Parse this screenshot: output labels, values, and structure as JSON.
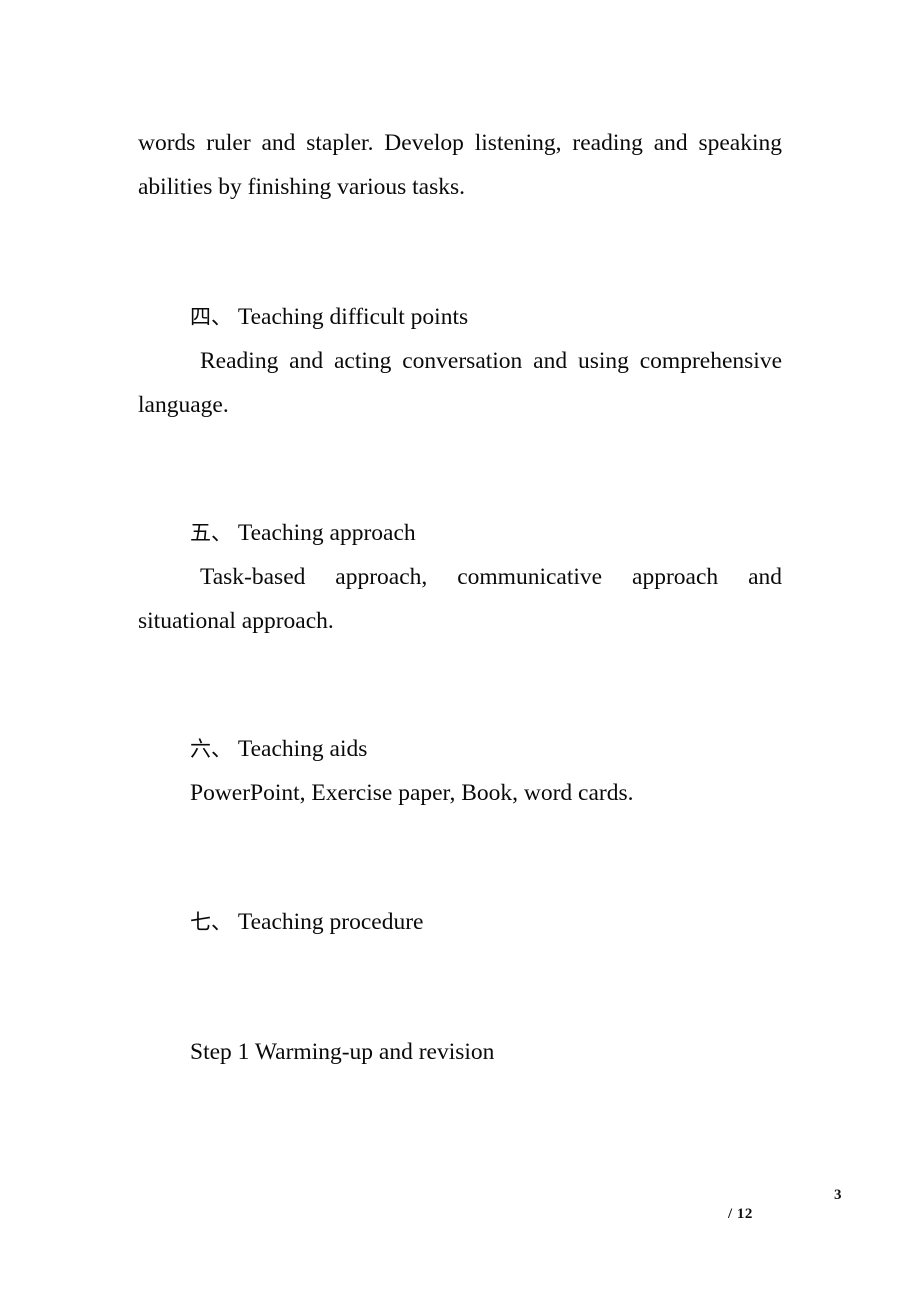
{
  "document": {
    "type": "lesson-plan",
    "language": "en-CN",
    "background_color": "#ffffff",
    "text_color": "#0a0a0a"
  },
  "body": {
    "intro_paragraph": "words ruler and stapler. Develop listening, reading and speaking abilities by finishing various tasks.",
    "sections": [
      {
        "numeral": "四",
        "separator": "、",
        "title": "Teaching difficult points",
        "content": "Reading and acting conversation and using comprehensive language."
      },
      {
        "numeral": "五",
        "separator": "、",
        "title": "Teaching approach",
        "content": "Task-based approach, communicative approach and situational approach."
      },
      {
        "numeral": "六",
        "separator": "、",
        "title": "Teaching aids",
        "content": "PowerPoint, Exercise paper, Book, word cards."
      },
      {
        "numeral": "七",
        "separator": "、",
        "title": "Teaching procedure",
        "content": ""
      }
    ],
    "step_heading": "Step 1 Warming-up and revision"
  },
  "lines": {
    "intro_line_1": "words ruler and stapler. Develop listening, reading and speaking",
    "intro_line_2": "abilities by finishing various tasks.",
    "sec4_line_1": "Reading and acting conversation and using comprehensive",
    "sec4_line_2": "language.",
    "sec5_line_1": "Task-based approach, communicative approach and",
    "sec5_line_2": "situational approach.",
    "sec6_line_1": "PowerPoint, Exercise paper, Book, word cards."
  },
  "footer": {
    "page_number": "3",
    "total_pages": "/ 12"
  }
}
